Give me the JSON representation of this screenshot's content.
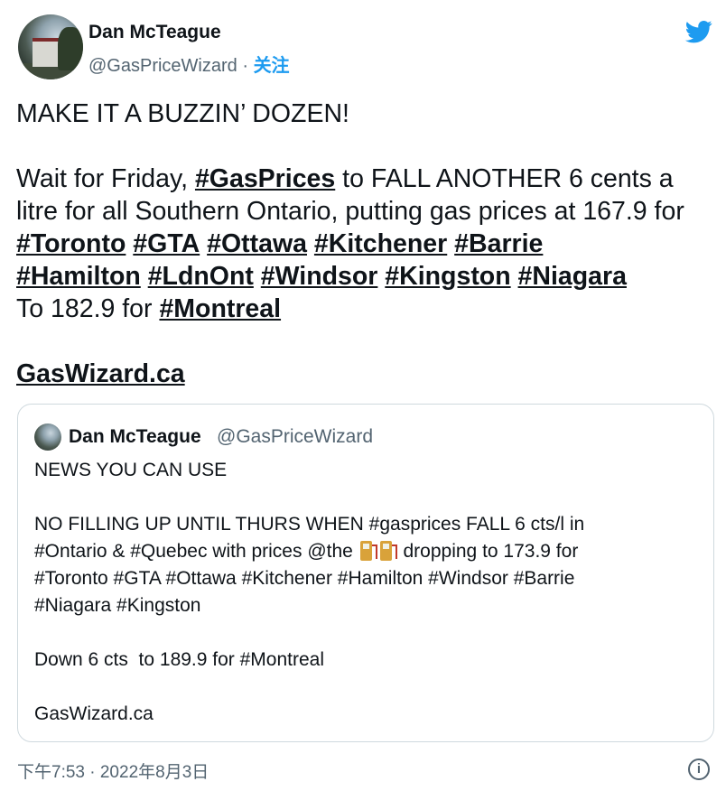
{
  "author": {
    "name": "Dan McTeague",
    "handle": "@GasPriceWizard",
    "separator": " · ",
    "follow_label": "关注"
  },
  "icons": {
    "logo": "twitter-bird-icon",
    "info": "info-icon"
  },
  "colors": {
    "accent": "#1d9bf0",
    "text": "#0f1419",
    "muted": "#536471",
    "border": "#cfd9de"
  },
  "tweet": {
    "t1": "MAKE IT A BUZZIN’ DOZEN!\n\nWait for Friday, ",
    "tag_gasprices": "#GasPrices",
    "t2": " to FALL ANOTHER 6 cents a litre for all Southern Ontario, putting gas prices at 167.9 for ",
    "tag_toronto": "#Toronto",
    "tag_gta": "#GTA",
    "tag_ottawa": "#Ottawa",
    "tag_kitchener": "#Kitchener",
    "tag_barrie": "#Barrie",
    "tag_hamilton": "#Hamilton",
    "tag_ldnont": "#LdnOnt",
    "tag_windsor": "#Windsor",
    "tag_kingston": "#Kingston",
    "tag_niagara": "#Niagara",
    "t3": "To 182.9 for ",
    "tag_montreal": "#Montreal",
    "link": "GasWizard.ca"
  },
  "quote": {
    "name": "Dan McTeague",
    "handle": "@GasPriceWizard",
    "text_a": "NEWS YOU CAN USE\n\nNO FILLING UP UNTIL THURS WHEN #gasprices FALL 6 cts/l in\n#Ontario & #Quebec with prices @the ",
    "text_b": " dropping to 173.9 for\n#Toronto #GTA #Ottawa #Kitchener #Hamilton #Windsor #Barrie\n#Niagara #Kingston\n\nDown 6 cts  to 189.9 for #Montreal\n\nGasWizard.ca"
  },
  "footer": {
    "time": "下午7:53 · 2022年8月3日"
  }
}
